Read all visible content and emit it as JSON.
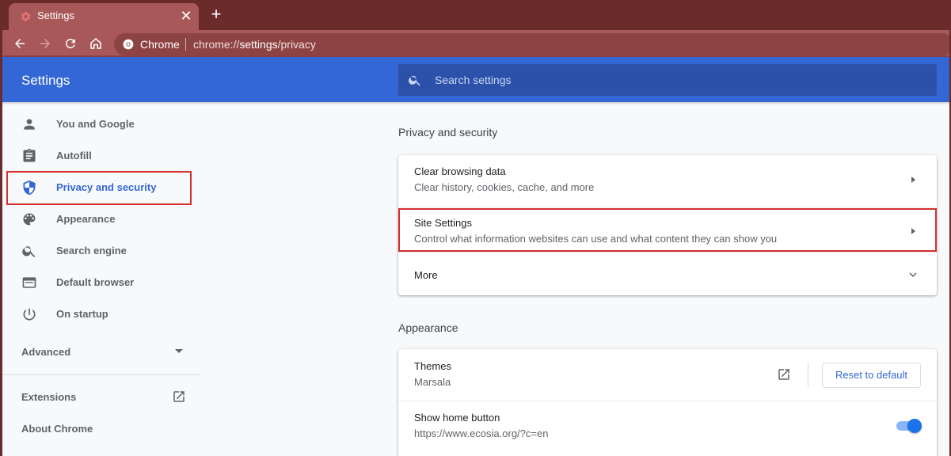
{
  "browser": {
    "tab_title": "Settings",
    "omnibox_chip": "Chrome",
    "url_scheme": "chrome://",
    "url_host": "settings",
    "url_path": "/privacy"
  },
  "header": {
    "title": "Settings",
    "search_placeholder": "Search settings"
  },
  "sidebar": {
    "items": [
      {
        "label": "You and Google",
        "icon": "person-icon"
      },
      {
        "label": "Autofill",
        "icon": "clipboard-icon"
      },
      {
        "label": "Privacy and security",
        "icon": "shield-icon",
        "active": true
      },
      {
        "label": "Appearance",
        "icon": "palette-icon"
      },
      {
        "label": "Search engine",
        "icon": "search-icon"
      },
      {
        "label": "Default browser",
        "icon": "browser-window-icon"
      },
      {
        "label": "On startup",
        "icon": "power-icon"
      }
    ],
    "advanced_label": "Advanced",
    "extensions_label": "Extensions",
    "about_label": "About Chrome"
  },
  "privacy": {
    "section_title": "Privacy and security",
    "clear_title": "Clear browsing data",
    "clear_desc": "Clear history, cookies, cache, and more",
    "site_title": "Site Settings",
    "site_desc": "Control what information websites can use and what content they can show you",
    "more_label": "More"
  },
  "appearance": {
    "section_title": "Appearance",
    "themes_label": "Themes",
    "themes_value": "Marsala",
    "reset_label": "Reset to default",
    "home_label": "Show home button",
    "home_value": "https://www.ecosia.org/?c=en",
    "home_enabled": true
  },
  "colors": {
    "frame": "#6b2b2b",
    "toolbar": "#a85858",
    "header_blue": "#3367d6",
    "highlight_red": "#d32f2f"
  }
}
